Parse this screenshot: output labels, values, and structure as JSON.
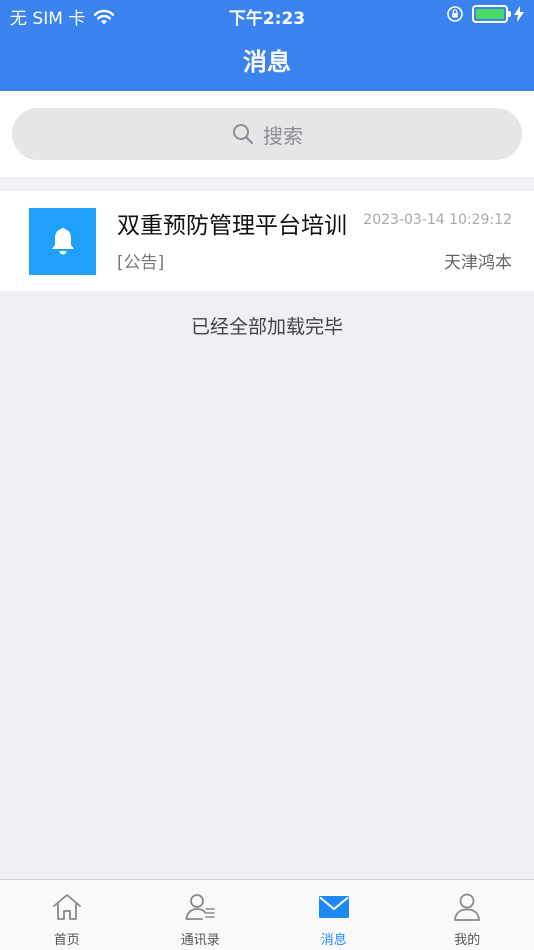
{
  "status_bar": {
    "carrier": "无 SIM 卡",
    "time": "下午2:23",
    "battery_level": 1.0
  },
  "header": {
    "title": "消息"
  },
  "search": {
    "placeholder": "搜索"
  },
  "messages": [
    {
      "title": "双重预防管理平台培训",
      "time": "2023-03-14 10:29:12",
      "type": "[公告]",
      "sender": "天津鸿本",
      "icon": "bell-icon"
    }
  ],
  "list_footer": "已经全部加载完毕",
  "tabs": [
    {
      "label": "首页",
      "icon": "home-icon",
      "active": false
    },
    {
      "label": "通讯录",
      "icon": "contacts-icon",
      "active": false
    },
    {
      "label": "消息",
      "icon": "mail-icon",
      "active": true
    },
    {
      "label": "我的",
      "icon": "user-icon",
      "active": false
    }
  ],
  "colors": {
    "header_bg": "#3b84ef",
    "accent": "#1e88f5",
    "notice_icon_bg": "#1ea0fb",
    "battery": "#4cd964",
    "page_bg": "#efeff4"
  }
}
